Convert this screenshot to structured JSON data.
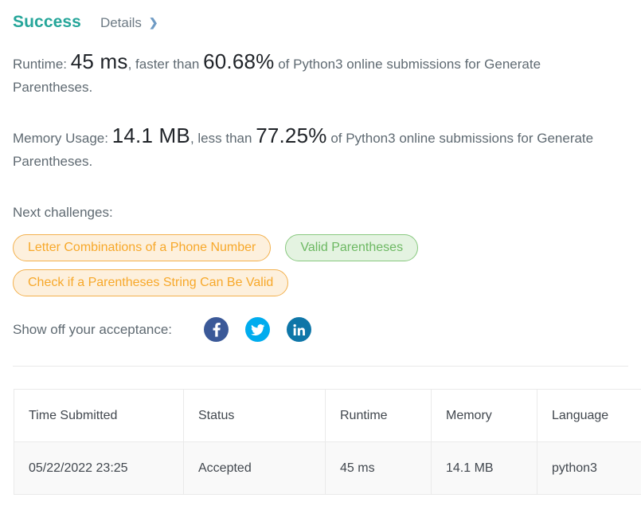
{
  "header": {
    "status_title": "Success",
    "details_label": "Details",
    "chevron_icon": "chevron-right-icon"
  },
  "stats": {
    "runtime": {
      "prefix": "Runtime:",
      "value": "45 ms",
      "middle": ", faster than",
      "percentile": "60.68%",
      "suffix": "of Python3 online submissions for Generate Parentheses."
    },
    "memory": {
      "prefix": "Memory Usage:",
      "value": "14.1 MB",
      "middle": ", less than",
      "percentile": "77.25%",
      "suffix": "of Python3 online submissions for Generate Parentheses."
    }
  },
  "challenges": {
    "label": "Next challenges:",
    "rows": [
      [
        {
          "label": "Letter Combinations of a Phone Number",
          "difficulty": "medium"
        },
        {
          "label": "Valid Parentheses",
          "difficulty": "easy"
        }
      ],
      [
        {
          "label": "Check if a Parentheses String Can Be Valid",
          "difficulty": "medium"
        }
      ]
    ]
  },
  "share": {
    "label": "Show off your acceptance:",
    "buttons": [
      {
        "name": "facebook-icon",
        "color": "#3b5998"
      },
      {
        "name": "twitter-icon",
        "color": "#00acee"
      },
      {
        "name": "linkedin-icon",
        "color": "#0e76a8"
      }
    ]
  },
  "table": {
    "columns": [
      "Time Submitted",
      "Status",
      "Runtime",
      "Memory",
      "Language"
    ],
    "rows": [
      {
        "time_submitted": "05/22/2022 23:25",
        "status": "Accepted",
        "runtime": "45 ms",
        "memory": "14.1 MB",
        "language": "python3"
      }
    ]
  },
  "colors": {
    "accent_teal": "#26a69a",
    "medium_orange": "#f7a82a",
    "easy_green": "#6cb862",
    "body_gray": "#5f6a72"
  }
}
